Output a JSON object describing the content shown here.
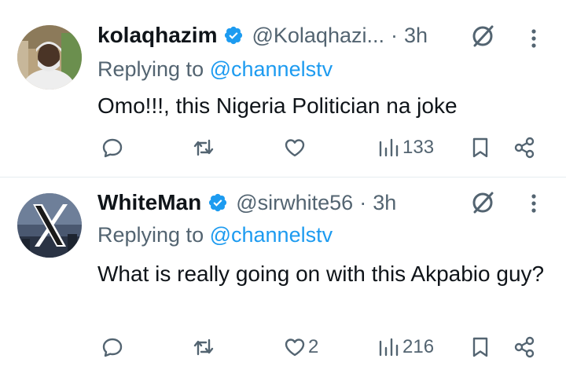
{
  "tweets": [
    {
      "name": "kolaqhazim",
      "handle": "@Kolaqhazi...",
      "separator": "·",
      "time": "3h",
      "replying_prefix": "Replying to ",
      "replying_to": "@channelstv",
      "text": "Omo!!!, this Nigeria Politician na joke",
      "reply_count": "",
      "retweet_count": "",
      "like_count": "",
      "views": "133"
    },
    {
      "name": "WhiteMan",
      "handle": "@sirwhite56",
      "separator": "·",
      "time": "3h",
      "replying_prefix": "Replying to ",
      "replying_to": "@channelstv",
      "text": "What is really going on with this Akpabio guy?",
      "reply_count": "",
      "retweet_count": "",
      "like_count": "2",
      "views": "216"
    }
  ],
  "colors": {
    "text": "#0f1419",
    "secondary": "#536471",
    "link": "#1d9bf0",
    "verified": "#1d9bf0",
    "divider": "#e6ecf0"
  },
  "icons": [
    "verified-badge-icon",
    "grok-icon",
    "more-icon",
    "reply-icon",
    "retweet-icon",
    "like-icon",
    "views-icon",
    "bookmark-icon",
    "share-icon"
  ]
}
